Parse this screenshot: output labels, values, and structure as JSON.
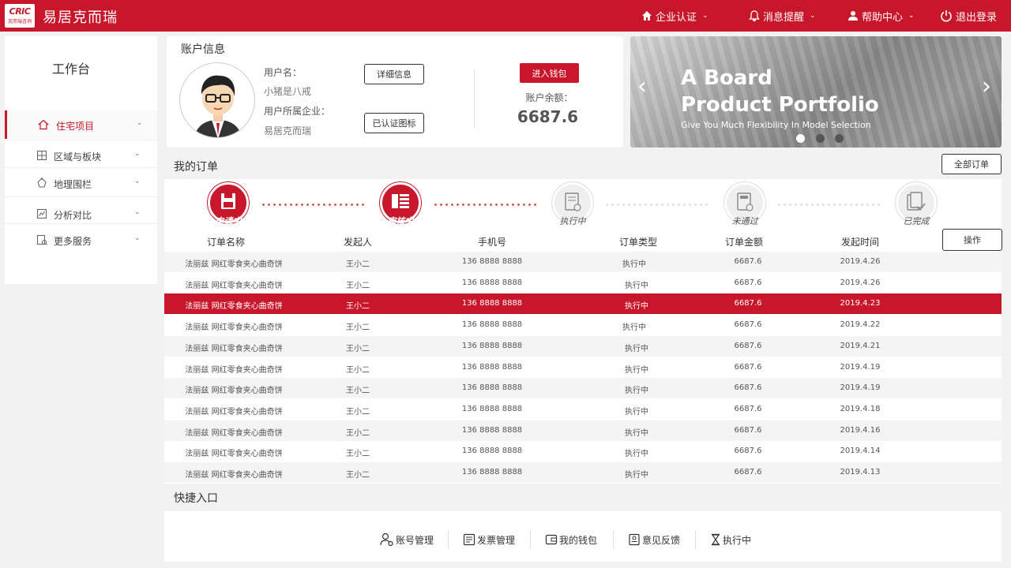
{
  "brand": {
    "logo_line1": "CRIC",
    "logo_line2": "克而瑞咨询",
    "name": "易居克而瑞"
  },
  "nav": {
    "enterprise": "企业认证",
    "messages": "消息提醒",
    "help": "帮助中心",
    "logout": "退出登录"
  },
  "sidebar": {
    "title": "工作台",
    "items": [
      {
        "label": "住宅项目",
        "icon": "home-icon"
      },
      {
        "label": "区域与板块",
        "icon": "grid-icon"
      },
      {
        "label": "地理围栏",
        "icon": "fence-icon"
      },
      {
        "label": "分析对比",
        "icon": "compare-icon"
      },
      {
        "label": "更多服务",
        "icon": "more-icon"
      }
    ]
  },
  "account": {
    "title": "账户信息",
    "username_label": "用户名：",
    "username": "小猪是八戒",
    "company_label": "用户所属企业：",
    "company": "易居克而瑞",
    "detail_button": "详细信息",
    "verified_button": "已认证图标",
    "wallet_button": "进入钱包",
    "balance_label": "账户余额：",
    "balance": "6687.6"
  },
  "banner": {
    "line1": "A Board",
    "line2": "Product Portfolio",
    "sub": "Give You Much Flexibility In Model Selection"
  },
  "orders": {
    "title": "我的订单",
    "all_button": "全部订单",
    "op_button": "操作",
    "steps": [
      "申请中",
      "审核中",
      "执行中",
      "未通过",
      "已完成"
    ],
    "columns": [
      "订单名称",
      "发起人",
      "手机号",
      "订单类型",
      "订单金额",
      "发起时间"
    ],
    "rows": [
      {
        "name": "法丽兹 网红零食夹心曲奇饼",
        "user": "王小二",
        "phone": "136 8888 8888",
        "type": "执行中",
        "amount": "6687.6",
        "date": "2019.4.26"
      },
      {
        "name": "法丽兹 网红零食夹心曲奇饼",
        "user": "王小二",
        "phone": "136 8888 8888",
        "type": "执行中",
        "amount": "6687.6",
        "date": "2019.4.26"
      },
      {
        "name": "法丽兹 网红零食夹心曲奇饼",
        "user": "王小二",
        "phone": "136 8888 8888",
        "type": "执行中",
        "amount": "6687.6",
        "date": "2019.4.23"
      },
      {
        "name": "法丽兹 网红零食夹心曲奇饼",
        "user": "王小二",
        "phone": "136 8888 8888",
        "type": "执行中",
        "amount": "6687.6",
        "date": "2019.4.22"
      },
      {
        "name": "法丽兹 网红零食夹心曲奇饼",
        "user": "王小二",
        "phone": "136 8888 8888",
        "type": "执行中",
        "amount": "6687.6",
        "date": "2019.4.21"
      },
      {
        "name": "法丽兹 网红零食夹心曲奇饼",
        "user": "王小二",
        "phone": "136 8888 8888",
        "type": "执行中",
        "amount": "6687.6",
        "date": "2019.4.19"
      },
      {
        "name": "法丽兹 网红零食夹心曲奇饼",
        "user": "王小二",
        "phone": "136 8888 8888",
        "type": "执行中",
        "amount": "6687.6",
        "date": "2019.4.19"
      },
      {
        "name": "法丽兹 网红零食夹心曲奇饼",
        "user": "王小二",
        "phone": "136 8888 8888",
        "type": "执行中",
        "amount": "6687.6",
        "date": "2019.4.18"
      },
      {
        "name": "法丽兹 网红零食夹心曲奇饼",
        "user": "王小二",
        "phone": "136 8888 8888",
        "type": "执行中",
        "amount": "6687.6",
        "date": "2019.4.16"
      },
      {
        "name": "法丽兹 网红零食夹心曲奇饼",
        "user": "王小二",
        "phone": "136 8888 8888",
        "type": "执行中",
        "amount": "6687.6",
        "date": "2019.4.14"
      },
      {
        "name": "法丽兹 网红零食夹心曲奇饼",
        "user": "王小二",
        "phone": "136 8888 8888",
        "type": "执行中",
        "amount": "6687.6",
        "date": "2019.4.13"
      }
    ]
  },
  "shortcuts": {
    "title": "快捷入口",
    "items": [
      "账号管理",
      "发票管理",
      "我的钱包",
      "意见反馈",
      "执行中"
    ]
  },
  "colors": {
    "accent": "#c8162a"
  }
}
